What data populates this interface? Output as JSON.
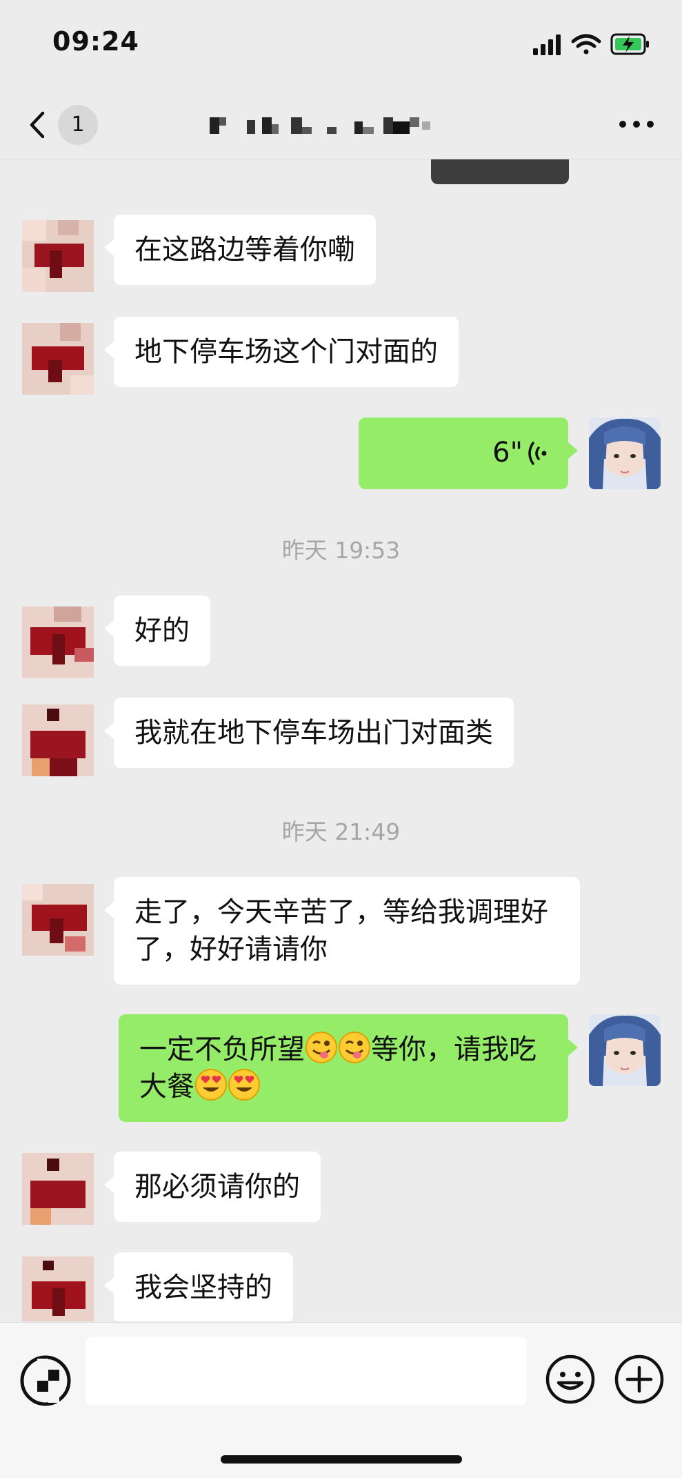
{
  "status_bar": {
    "time": "09:24"
  },
  "nav": {
    "unread_count": "1"
  },
  "messages": {
    "m1": "在这路边等着你嘞",
    "m2": "地下停车场这个门对面的",
    "voice_duration": "6\"",
    "ts1": "昨天 19:53",
    "m3": "好的",
    "m4": "我就在地下停车场出门对面类",
    "ts2": "昨天 21:49",
    "m5": "走了，今天辛苦了，等给我调理好了，好好请请你",
    "m6a": "一定不负所望",
    "m6b": "等你，请我吃大餐",
    "m7": "那必须请你的",
    "m8": "我会坚持的"
  },
  "colors": {
    "outgoing_bubble": "#95ec69",
    "incoming_bubble": "#ffffff",
    "background": "#ececec"
  },
  "icons": [
    "back-chevron",
    "more-dots",
    "voice-wave",
    "emoji-wink-tongue",
    "emoji-heart-eyes",
    "keyboard-voice-toggle",
    "smiley",
    "plus-circle"
  ]
}
